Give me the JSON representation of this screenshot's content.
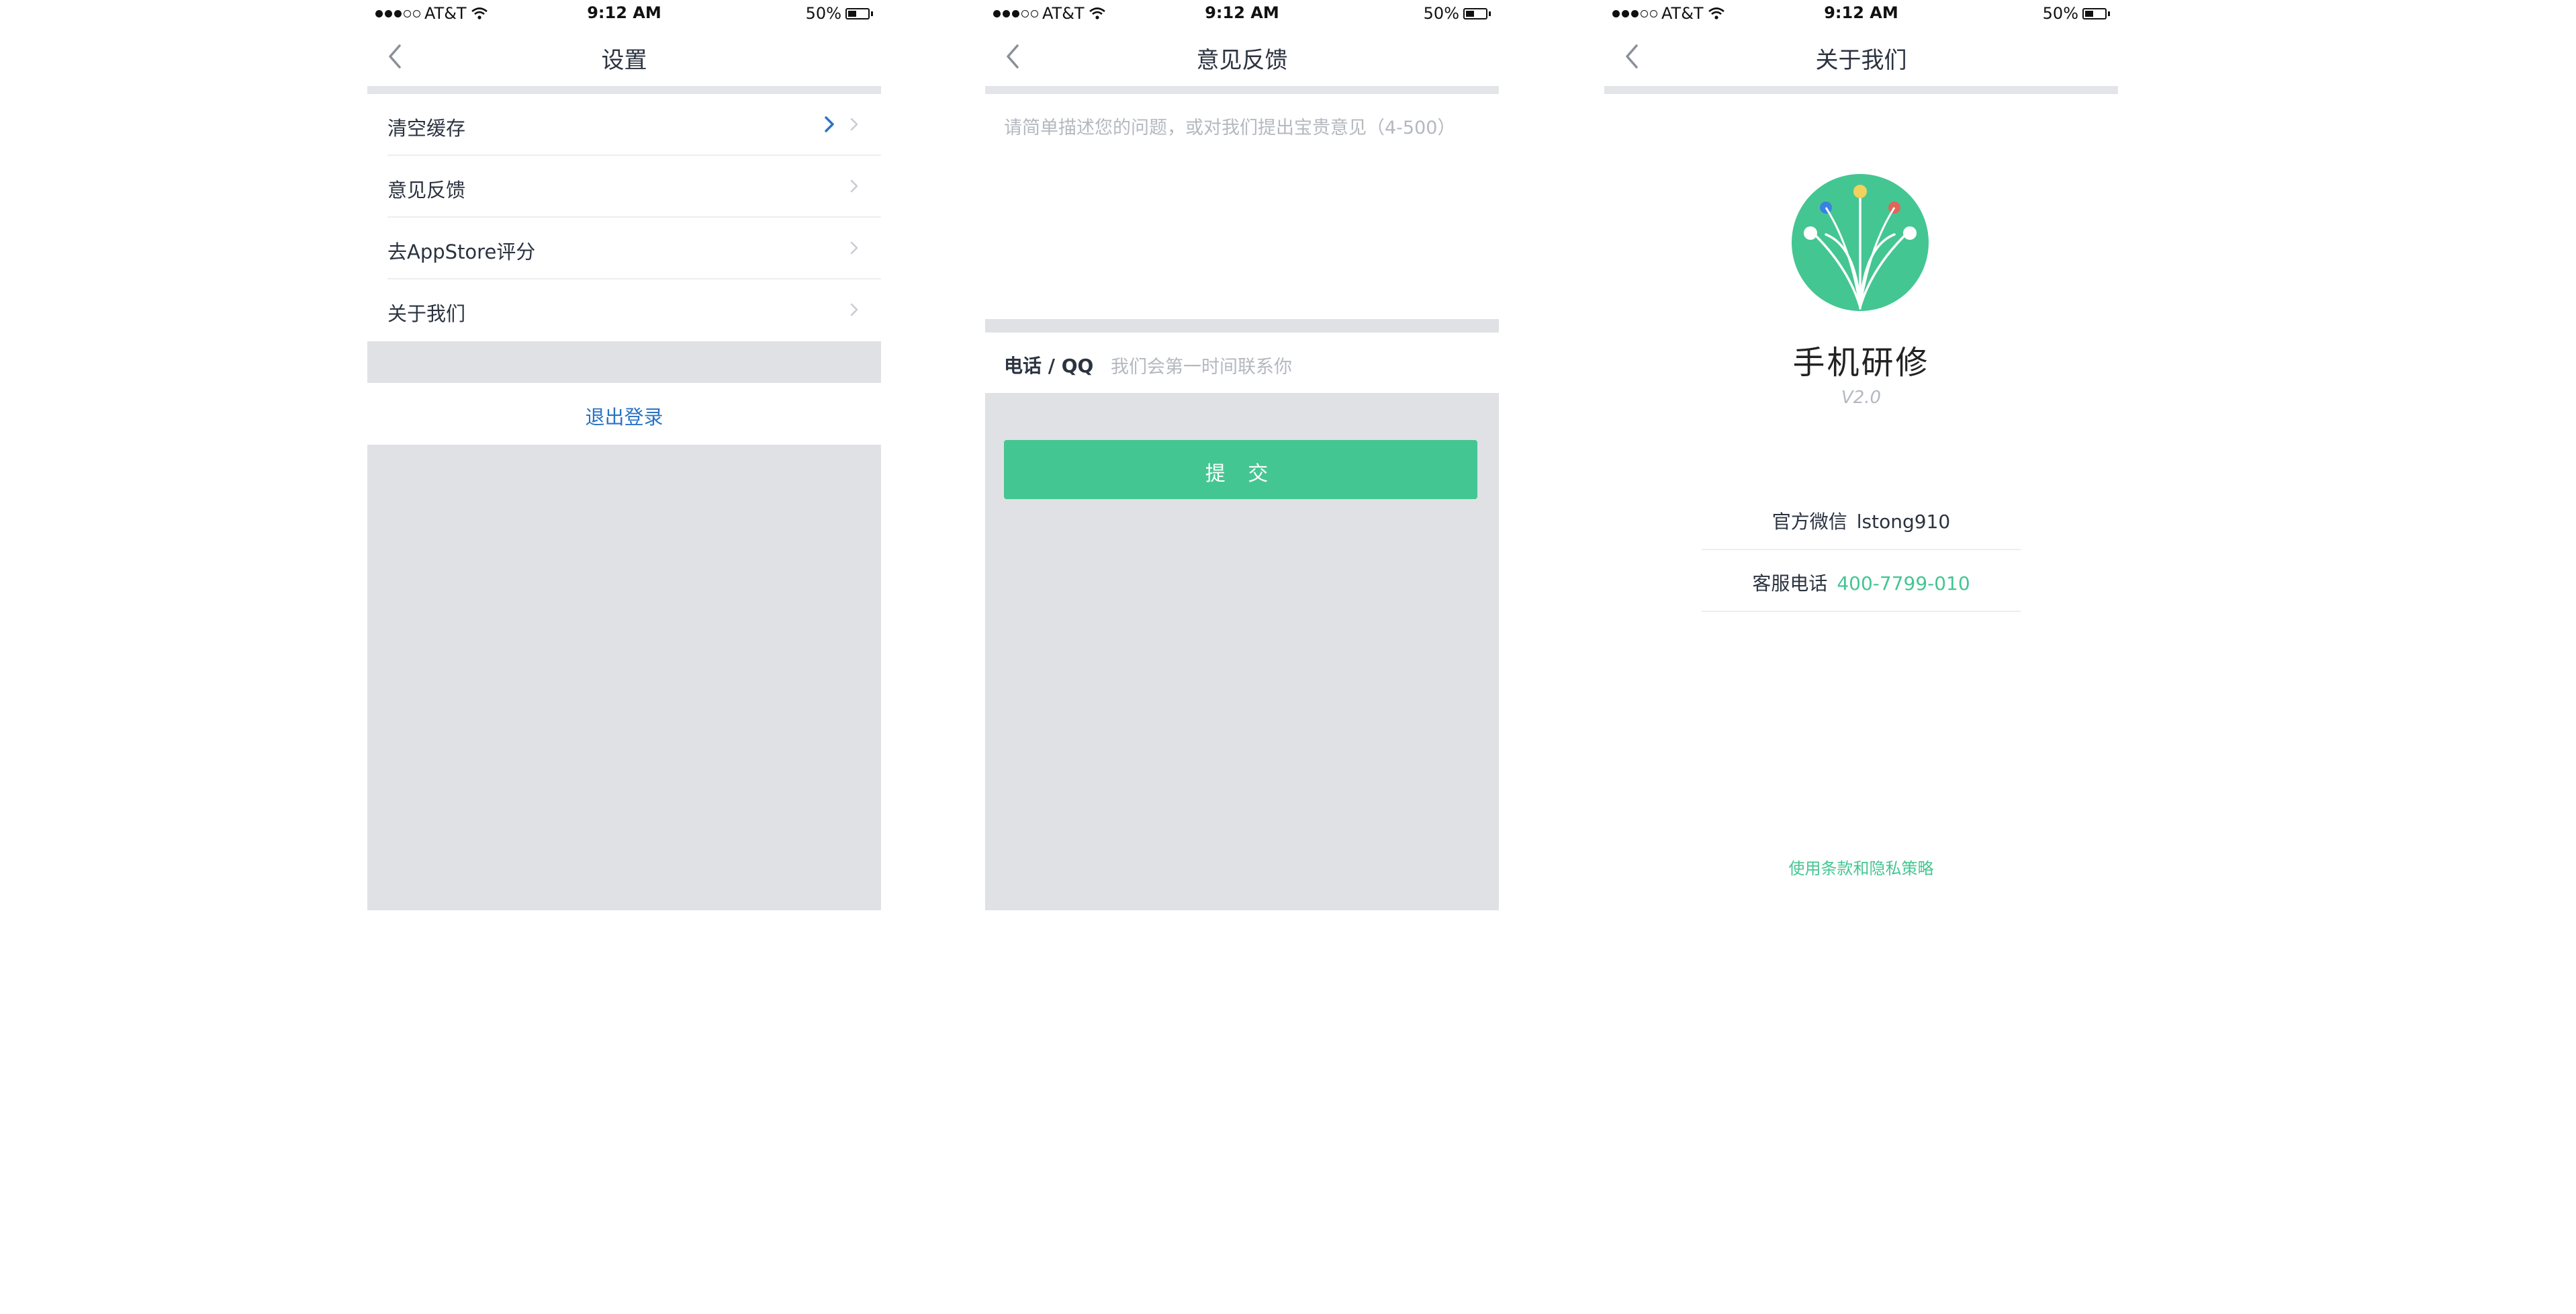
{
  "status_bar": {
    "carrier": "AT&T",
    "time": "9:12 AM",
    "battery": "50%",
    "battery_level": 0.5,
    "signal_bars_filled": 3,
    "signal_bars_total": 5
  },
  "settings": {
    "title": "设置",
    "items": [
      {
        "label": "清空缓存"
      },
      {
        "label": "意见反馈"
      },
      {
        "label": "去AppStore评分"
      },
      {
        "label": "关于我们"
      }
    ],
    "logout_label": "退出登录"
  },
  "feedback": {
    "title": "意见反馈",
    "textarea_placeholder": "请简单描述您的问题，或对我们提出宝贵意见（4-500）",
    "contact_label": "电话 / QQ",
    "contact_placeholder": "我们会第一时间联系你",
    "submit_label": "提 交"
  },
  "about": {
    "title": "关于我们",
    "app_name": "手机研修",
    "version": "V2.0",
    "wechat_label": "官方微信",
    "wechat_value": "lstong910",
    "phone_label": "客服电话",
    "phone_value": "400-7799-010",
    "policy_link": "使用条款和隐私策略"
  },
  "colors": {
    "accent_green": "#44c692",
    "link_blue": "#2a73c4",
    "background_gray": "#dfe1e5",
    "logo_dot_blue": "#3b82e0",
    "logo_dot_yellow": "#f2d15c",
    "logo_dot_red": "#e0665a"
  },
  "icons": {
    "back": "chevron-left-icon",
    "row_arrow": "chevron-right-icon",
    "wifi": "wifi-icon",
    "battery": "battery-icon",
    "logo": "app-logo"
  }
}
